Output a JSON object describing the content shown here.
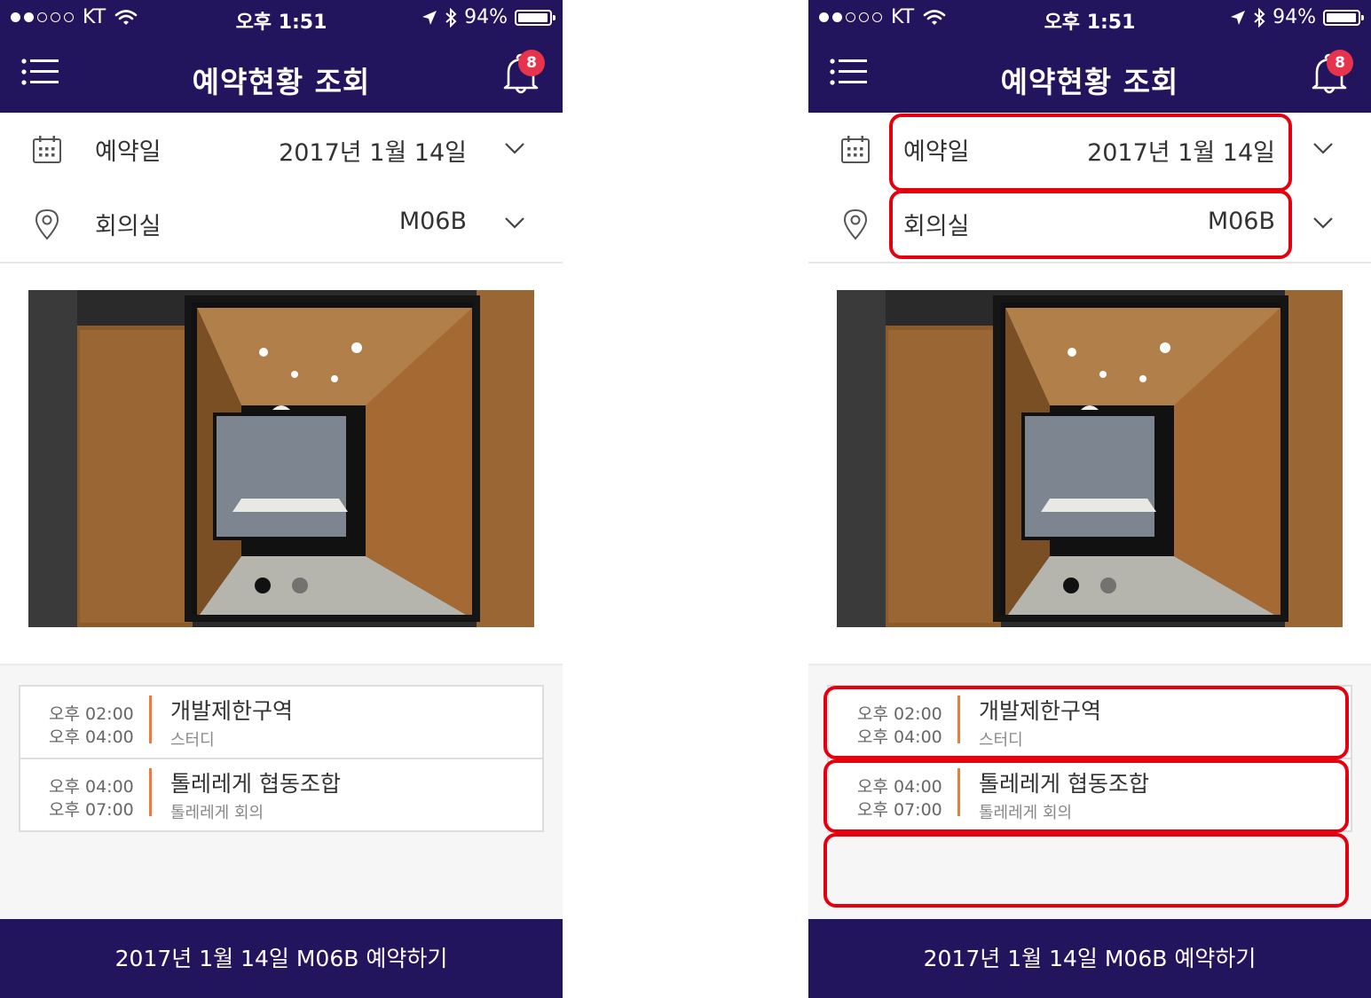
{
  "status_bar": {
    "carrier": "KT",
    "time": "오후 1:51",
    "battery": "94%"
  },
  "header": {
    "title": "예약현황 조회",
    "badge_count": "8"
  },
  "filters": {
    "date": {
      "label": "예약일",
      "value": "2017년 1월 14일"
    },
    "room": {
      "label": "회의실",
      "value": "M06B"
    }
  },
  "carousel": {
    "total": 2,
    "active": 0
  },
  "reservations": [
    {
      "start": "오후 02:00",
      "end": "오후 04:00",
      "title": "개발제한구역",
      "subtitle": "스터디"
    },
    {
      "start": "오후 04:00",
      "end": "오후 07:00",
      "title": "톨레레게 협동조합",
      "subtitle": "톨레레게 회의"
    }
  ],
  "footer": {
    "button_label": "2017년 1월 14일 M06B 예약하기"
  },
  "colors": {
    "header_bg": "#23155d",
    "accent_bar": "#ef7a3a",
    "badge": "#e8334d",
    "highlight": "#e5000e"
  }
}
